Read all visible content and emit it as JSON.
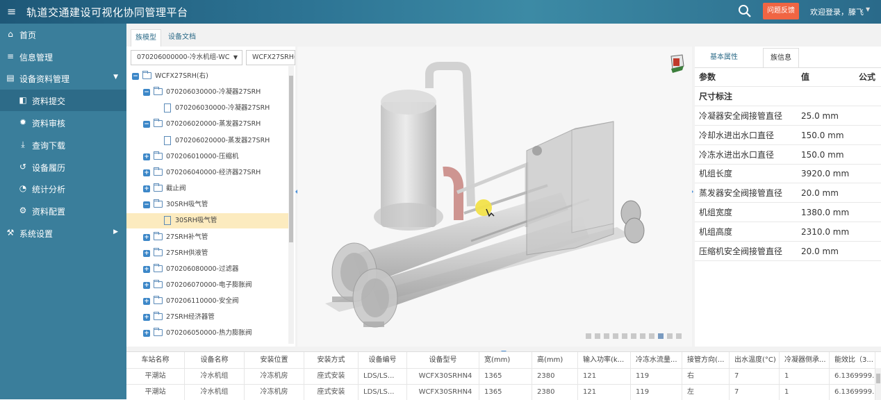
{
  "header": {
    "menu_icon": "menu-icon",
    "title": "轨道交通建设可视化协同管理平台",
    "feedback_label": "问题反馈",
    "welcome_text": "欢迎登录，滕飞"
  },
  "sidebar": {
    "items": [
      {
        "label": "首页",
        "icon": "home-icon"
      },
      {
        "label": "信息管理",
        "icon": "list-icon"
      },
      {
        "label": "设备资料管理",
        "icon": "device-icon"
      },
      {
        "label": "资料提交",
        "icon": "folder-open-icon"
      },
      {
        "label": "资料审核",
        "icon": "gear-icon"
      },
      {
        "label": "查询下载",
        "icon": "download-icon"
      },
      {
        "label": "设备履历",
        "icon": "history-icon"
      },
      {
        "label": "统计分析",
        "icon": "pie-chart-icon"
      },
      {
        "label": "资料配置",
        "icon": "cog-icon"
      },
      {
        "label": "系统设置",
        "icon": "wrench-icon"
      }
    ]
  },
  "tabs": {
    "family_model": "族模型",
    "device_docs": "设备文档"
  },
  "selects": {
    "category": "070206000000-冷水机组-WC",
    "model": "WCFX27SRH("
  },
  "tree": [
    {
      "label": "WCFX27SRH(右)",
      "level": 0,
      "type": "folder",
      "state": "open"
    },
    {
      "label": "070206030000-冷凝器27SRH",
      "level": 1,
      "type": "folder",
      "state": "open"
    },
    {
      "label": "070206030000-冷凝器27SRH",
      "level": 2,
      "type": "file"
    },
    {
      "label": "070206020000-蒸发器27SRH",
      "level": 1,
      "type": "folder",
      "state": "open"
    },
    {
      "label": "070206020000-蒸发器27SRH",
      "level": 2,
      "type": "file"
    },
    {
      "label": "070206010000-压缩机",
      "level": 1,
      "type": "folder",
      "state": "closed"
    },
    {
      "label": "070206040000-经济器27SRH",
      "level": 1,
      "type": "folder",
      "state": "closed"
    },
    {
      "label": "截止阀",
      "level": 1,
      "type": "folder",
      "state": "closed"
    },
    {
      "label": "30SRH吸气管",
      "level": 1,
      "type": "folder",
      "state": "open"
    },
    {
      "label": "30SRH吸气管",
      "level": 2,
      "type": "file",
      "selected": true
    },
    {
      "label": "27SRH补气管",
      "level": 1,
      "type": "folder",
      "state": "closed"
    },
    {
      "label": "27SRH供液管",
      "level": 1,
      "type": "folder",
      "state": "closed"
    },
    {
      "label": "070206080000-过滤器",
      "level": 1,
      "type": "folder",
      "state": "closed"
    },
    {
      "label": "070206070000-电子膨胀阀",
      "level": 1,
      "type": "folder",
      "state": "closed"
    },
    {
      "label": "070206110000-安全阀",
      "level": 1,
      "type": "folder",
      "state": "closed"
    },
    {
      "label": "27SRH经济器管",
      "level": 1,
      "type": "folder",
      "state": "closed"
    },
    {
      "label": "070206050000-热力膨胀阀",
      "level": 1,
      "type": "folder",
      "state": "closed"
    }
  ],
  "props": {
    "tab_basic": "基本属性",
    "tab_family": "族信息",
    "headers": {
      "param": "参数",
      "value": "值",
      "formula": "公式"
    },
    "group": "尺寸标注",
    "rows": [
      {
        "k": "冷凝器安全阀接管直径",
        "v": "25.0 mm"
      },
      {
        "k": "冷却水进出水口直径",
        "v": "150.0 mm"
      },
      {
        "k": "冷冻水进出水口直径",
        "v": "150.0 mm"
      },
      {
        "k": "机组长度",
        "v": "3920.0 mm"
      },
      {
        "k": "蒸发器安全阀接管直径",
        "v": "20.0 mm"
      },
      {
        "k": "机组宽度",
        "v": "1380.0 mm"
      },
      {
        "k": "机组高度",
        "v": "2310.0 mm"
      },
      {
        "k": "压缩机安全阀接管直径",
        "v": "20.0 mm"
      }
    ]
  },
  "table": {
    "headers": [
      "车站名称",
      "设备名称",
      "安装位置",
      "安装方式",
      "设备编号",
      "设备型号",
      "宽(mm)",
      "高(mm)",
      "输入功率(k...",
      "冷冻水流量...",
      "接管方向(...",
      "出水温度(°C)",
      "冷凝器侧承...",
      "能效比（3..."
    ],
    "rows": [
      [
        "平潮站",
        "冷水机组",
        "冷冻机房",
        "座式安装",
        "LDS/LS...",
        "WCFX30SRHN4",
        "1365",
        "2380",
        "121",
        "119",
        "右",
        "7",
        "1",
        "6.1369999..."
      ],
      [
        "平潮站",
        "冷水机组",
        "冷冻机房",
        "座式安装",
        "LDS/LS...",
        "WCFX30SRHN4",
        "1365",
        "2380",
        "121",
        "119",
        "左",
        "7",
        "1",
        "6.1369999..."
      ]
    ]
  },
  "colors": {
    "topbar": "#2d7494",
    "sidebar": "#3a7e9b",
    "sidebar_active": "#2d6b88",
    "feedback": "#f06543",
    "tree_selected": "#fcebbf"
  }
}
